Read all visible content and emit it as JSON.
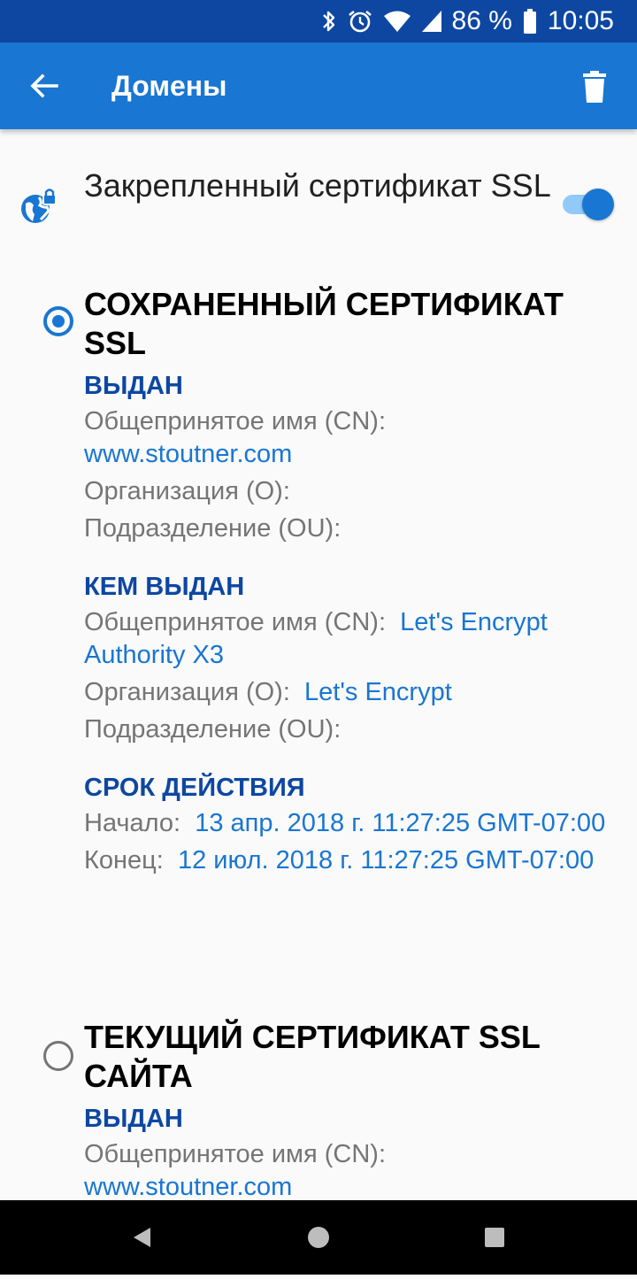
{
  "status_bar": {
    "battery": "86 %",
    "time": "10:05",
    "icons": [
      "bluetooth-icon",
      "alarm-icon",
      "wifi-icon",
      "signal-icon",
      "battery-icon"
    ]
  },
  "app_bar": {
    "title": "Домены",
    "back_icon": "arrow-back-icon",
    "delete_icon": "delete-icon"
  },
  "pinned_ssl": {
    "label": "Закрепленный сертификат SSL",
    "enabled": true,
    "icon": "globe-lock-icon"
  },
  "saved_cert": {
    "title": "СОХРАНЕННЫЙ СЕРТИФИКАТ SSL",
    "selected": true,
    "issued_to": {
      "heading": "ВЫДАН",
      "cn_label": "Общепринятое имя (CN):",
      "cn_value": "www.stoutner.com",
      "o_label": "Организация (O):",
      "o_value": "",
      "ou_label": "Подразделение (OU):",
      "ou_value": ""
    },
    "issued_by": {
      "heading": "КЕМ ВЫДАН",
      "cn_label": "Общепринятое имя (CN):",
      "cn_value": "Let's Encrypt Authority X3",
      "o_label": "Организация (O):",
      "o_value": "Let's Encrypt",
      "ou_label": "Подразделение (OU):",
      "ou_value": ""
    },
    "validity": {
      "heading": "СРОК ДЕЙСТВИЯ",
      "start_label": "Начало:",
      "start_value": "13 апр. 2018 г. 11:27:25 GMT-07:00",
      "end_label": "Конец:",
      "end_value": "12 июл. 2018 г. 11:27:25 GMT-07:00"
    }
  },
  "current_cert": {
    "title": "ТЕКУЩИЙ СЕРТИФИКАТ SSL САЙТА",
    "selected": false,
    "issued_to": {
      "heading": "ВЫДАН",
      "cn_label": "Общепринятое имя (CN):",
      "cn_value": "www.stoutner.com"
    }
  },
  "nav_bar": {
    "icons": [
      "back-triangle-icon",
      "home-circle-icon",
      "recents-square-icon"
    ]
  },
  "colors": {
    "status_bar": "#0d47a1",
    "app_bar": "#1976d2",
    "accent": "#1976d2",
    "section_heading": "#0d47a1"
  }
}
